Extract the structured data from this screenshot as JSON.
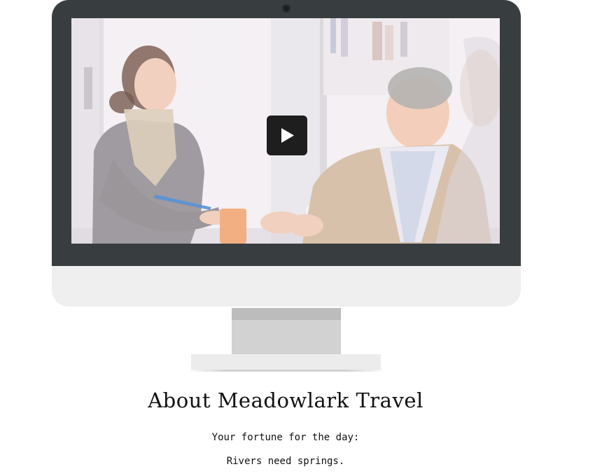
{
  "video": {
    "play_icon": "play-icon"
  },
  "about": {
    "heading": "About Meadowlark Travel",
    "fortune_intro": "Your fortune for the day:",
    "fortune": "Rivers need springs."
  }
}
